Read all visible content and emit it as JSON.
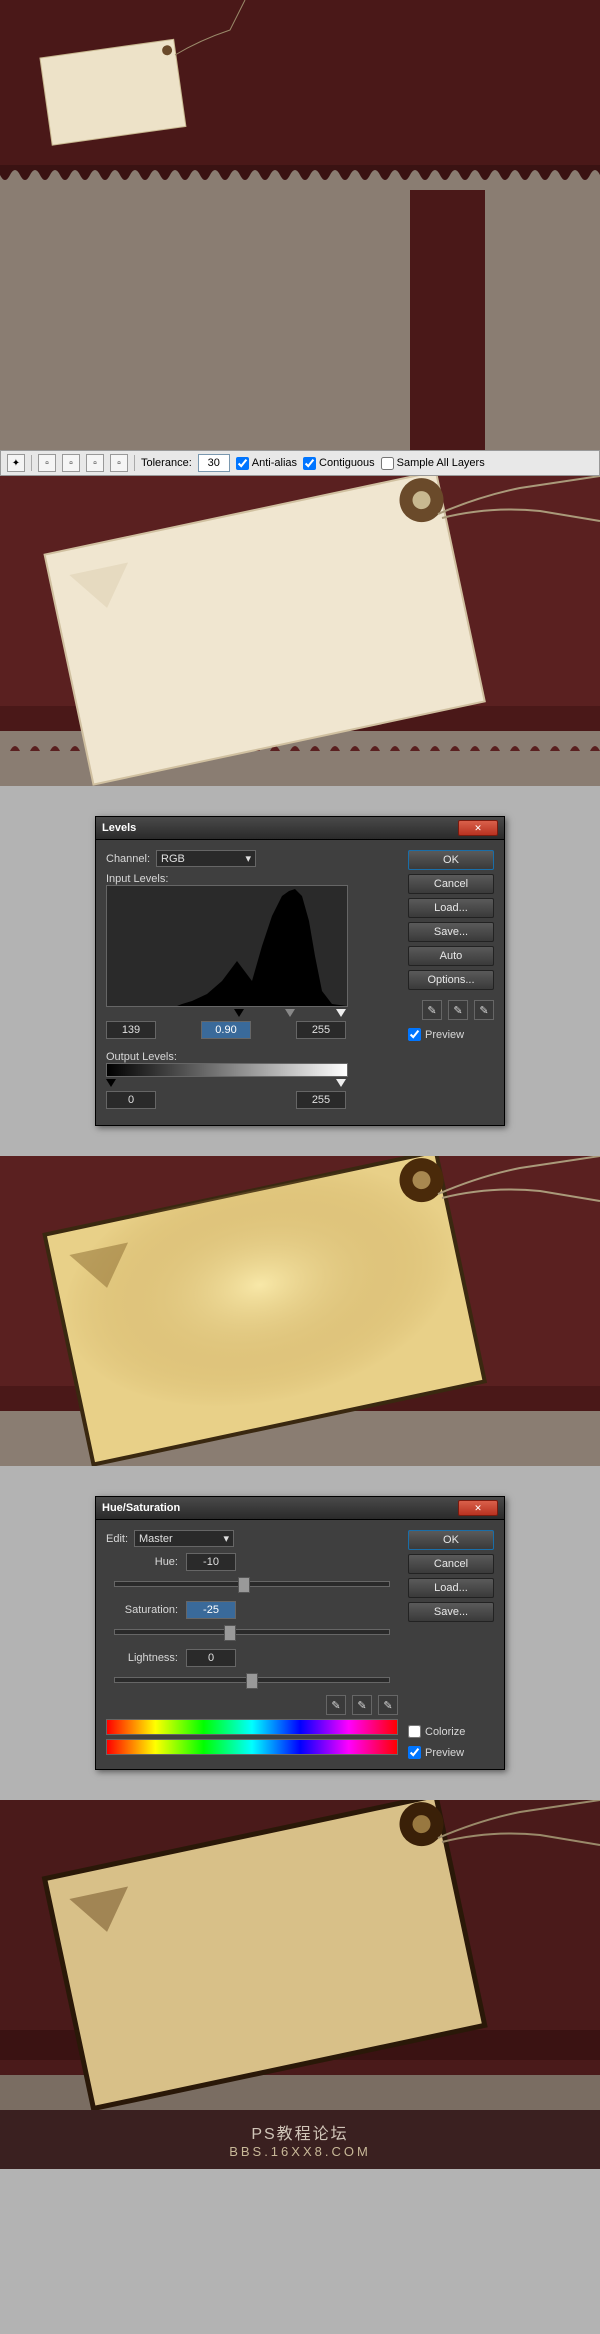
{
  "toolbar": {
    "tolerance_label": "Tolerance:",
    "tolerance_value": "30",
    "anti_alias": "Anti-alias",
    "contiguous": "Contiguous",
    "sample_all": "Sample All Layers"
  },
  "levels": {
    "title": "Levels",
    "channel_label": "Channel:",
    "channel_value": "RGB",
    "input_label": "Input Levels:",
    "output_label": "Output Levels:",
    "in_black": "139",
    "in_gamma": "0.90",
    "in_white": "255",
    "out_black": "0",
    "out_white": "255",
    "ok": "OK",
    "cancel": "Cancel",
    "load": "Load...",
    "save": "Save...",
    "auto": "Auto",
    "options": "Options...",
    "preview": "Preview"
  },
  "hs": {
    "title": "Hue/Saturation",
    "edit_label": "Edit:",
    "edit_value": "Master",
    "hue_label": "Hue:",
    "hue_value": "-10",
    "sat_label": "Saturation:",
    "sat_value": "-25",
    "light_label": "Lightness:",
    "light_value": "0",
    "ok": "OK",
    "cancel": "Cancel",
    "load": "Load...",
    "save": "Save...",
    "colorize": "Colorize",
    "preview": "Preview"
  },
  "footer": {
    "line1": "PS教程论坛",
    "line2": "BBS.16XX8.COM"
  }
}
